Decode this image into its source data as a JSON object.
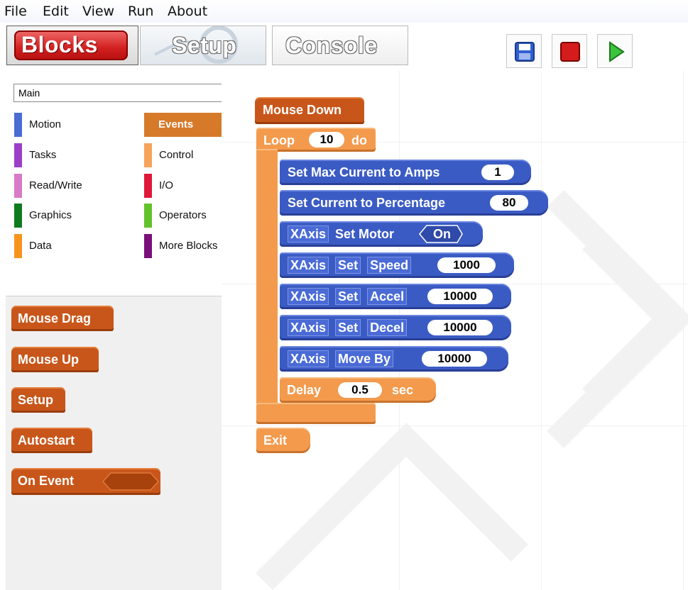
{
  "menu": [
    "File",
    "Edit",
    "View",
    "Run",
    "About"
  ],
  "tabs": {
    "blocks": "Blocks",
    "setup": "Setup",
    "console": "Console"
  },
  "sprite_select": "Main",
  "categories_left": [
    {
      "label": "Motion",
      "color": "#4a6cd4"
    },
    {
      "label": "Tasks",
      "color": "#9b3fc8"
    },
    {
      "label": "Read/Write",
      "color": "#d87ac8"
    },
    {
      "label": "Graphics",
      "color": "#0f7a1e"
    },
    {
      "label": "Data",
      "color": "#f7941d"
    }
  ],
  "categories_right": [
    {
      "label": "Events",
      "color": "#d67a2a"
    },
    {
      "label": "Control",
      "color": "#f7a35c"
    },
    {
      "label": "I/O",
      "color": "#e0183a"
    },
    {
      "label": "Operators",
      "color": "#62c22a"
    },
    {
      "label": "More Blocks",
      "color": "#7a0f7a"
    }
  ],
  "palette": {
    "mouse_drag": "Mouse Drag",
    "mouse_up": "Mouse Up",
    "setup": "Setup",
    "autostart": "Autostart",
    "on_event": "On Event"
  },
  "script": {
    "hat": "Mouse Down",
    "loop_label": "Loop",
    "loop_count": "10",
    "loop_do": "do",
    "set_max_current": "Set Max Current to Amps",
    "max_current_val": "1",
    "set_current_pct": "Set Current to Percentage",
    "current_pct_val": "80",
    "axis": "XAxis",
    "set_motor": "Set Motor",
    "motor_val": "On",
    "set": "Set",
    "speed": "Speed",
    "speed_val": "1000",
    "accel": "Accel",
    "accel_val": "10000",
    "decel": "Decel",
    "decel_val": "10000",
    "move_by": "Move By",
    "move_val": "10000",
    "delay": "Delay",
    "delay_val": "0.5",
    "sec": "sec",
    "exit": "Exit"
  },
  "colors": {
    "events_hat": "#c8561a",
    "control": "#f39a4d",
    "motion": "#3b5bc4",
    "stop": "#d41c1c",
    "run": "#2fb52f"
  }
}
